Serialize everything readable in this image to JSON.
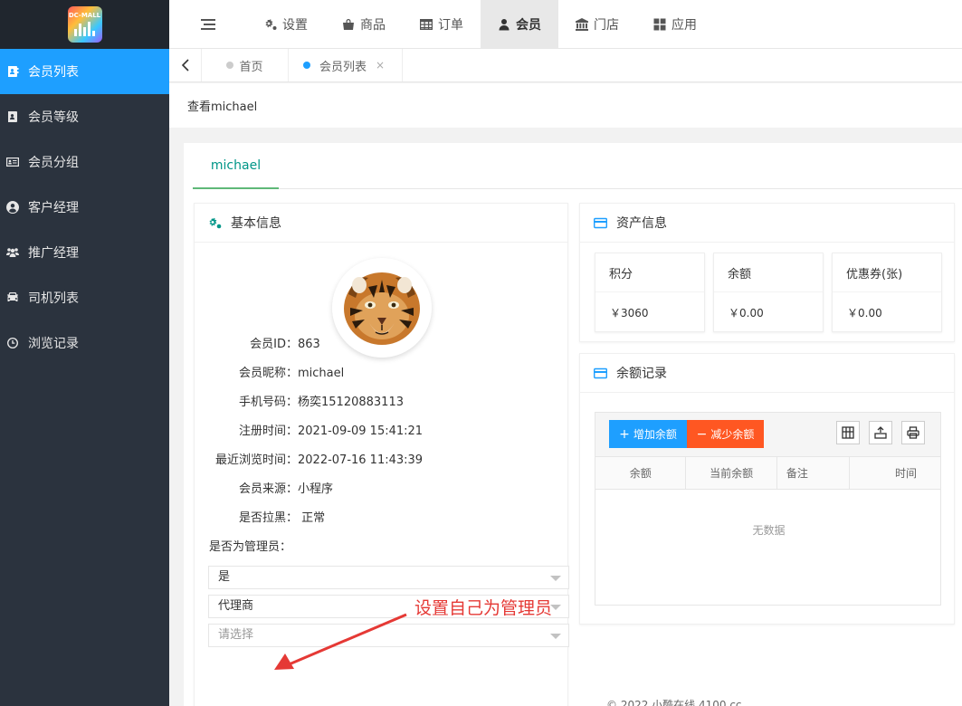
{
  "logo": {
    "text": "DC-MALL"
  },
  "sidebar": {
    "items": [
      {
        "label": "会员列表",
        "icon": "member-book-icon",
        "active": true
      },
      {
        "label": "会员等级",
        "icon": "level-book-icon"
      },
      {
        "label": "会员分组",
        "icon": "id-card-icon"
      },
      {
        "label": "客户经理",
        "icon": "user-circle-icon"
      },
      {
        "label": "推广经理",
        "icon": "users-icon"
      },
      {
        "label": "司机列表",
        "icon": "car-icon"
      },
      {
        "label": "浏览记录",
        "icon": "clock-icon"
      }
    ]
  },
  "topnav": {
    "items": [
      {
        "label": "设置",
        "icon": "gears-icon"
      },
      {
        "label": "商品",
        "icon": "bag-icon"
      },
      {
        "label": "订单",
        "icon": "table-icon"
      },
      {
        "label": "会员",
        "icon": "user-icon",
        "active": true
      },
      {
        "label": "门店",
        "icon": "bank-icon"
      },
      {
        "label": "应用",
        "icon": "grid-icon"
      }
    ]
  },
  "tabs": [
    {
      "label": "首页"
    },
    {
      "label": "会员列表",
      "close": "×",
      "active": true
    }
  ],
  "page_header": {
    "title": "查看michael"
  },
  "inner_tab": {
    "label": "michael"
  },
  "basic": {
    "title": "基本信息",
    "rows": [
      {
        "label": "会员ID：",
        "value": "863"
      },
      {
        "label": "会员昵称：",
        "value": "michael"
      },
      {
        "label": "手机号码：",
        "value": "杨奕15120883113"
      },
      {
        "label": "注册时间：",
        "value": "2021-09-09 15:41:21"
      },
      {
        "label": "最近浏览时间：",
        "value": "2022-07-16 11:43:39"
      },
      {
        "label": "会员来源：",
        "value": "小程序"
      },
      {
        "label": "是否拉黑：",
        "value": " 正常"
      }
    ],
    "admin_label": "是否为管理员：",
    "selects": [
      {
        "value": "是"
      },
      {
        "value": "代理商"
      },
      {
        "placeholder": "请选择"
      }
    ]
  },
  "annotation": {
    "text": "设置自己为管理员",
    "color": "#e53935"
  },
  "assets": {
    "title": "资产信息",
    "cards": [
      {
        "title": "积分",
        "value": "￥3060"
      },
      {
        "title": "余额",
        "value": "￥0.00"
      },
      {
        "title": "优惠券(张)",
        "value": "￥0.00"
      }
    ]
  },
  "balance": {
    "title": "余额记录",
    "add_label": "增加余额",
    "sub_label": "减少余额",
    "columns": [
      "余额",
      "当前余额",
      "备注",
      "时间"
    ],
    "empty_text": "无数据"
  },
  "footer": {
    "text": "© 2022 小酷在线 4100.cc"
  },
  "colors": {
    "accent": "#1e9fff",
    "danger": "#ff5722",
    "sidebar": "#2b333e",
    "tab_green": "#009688"
  }
}
